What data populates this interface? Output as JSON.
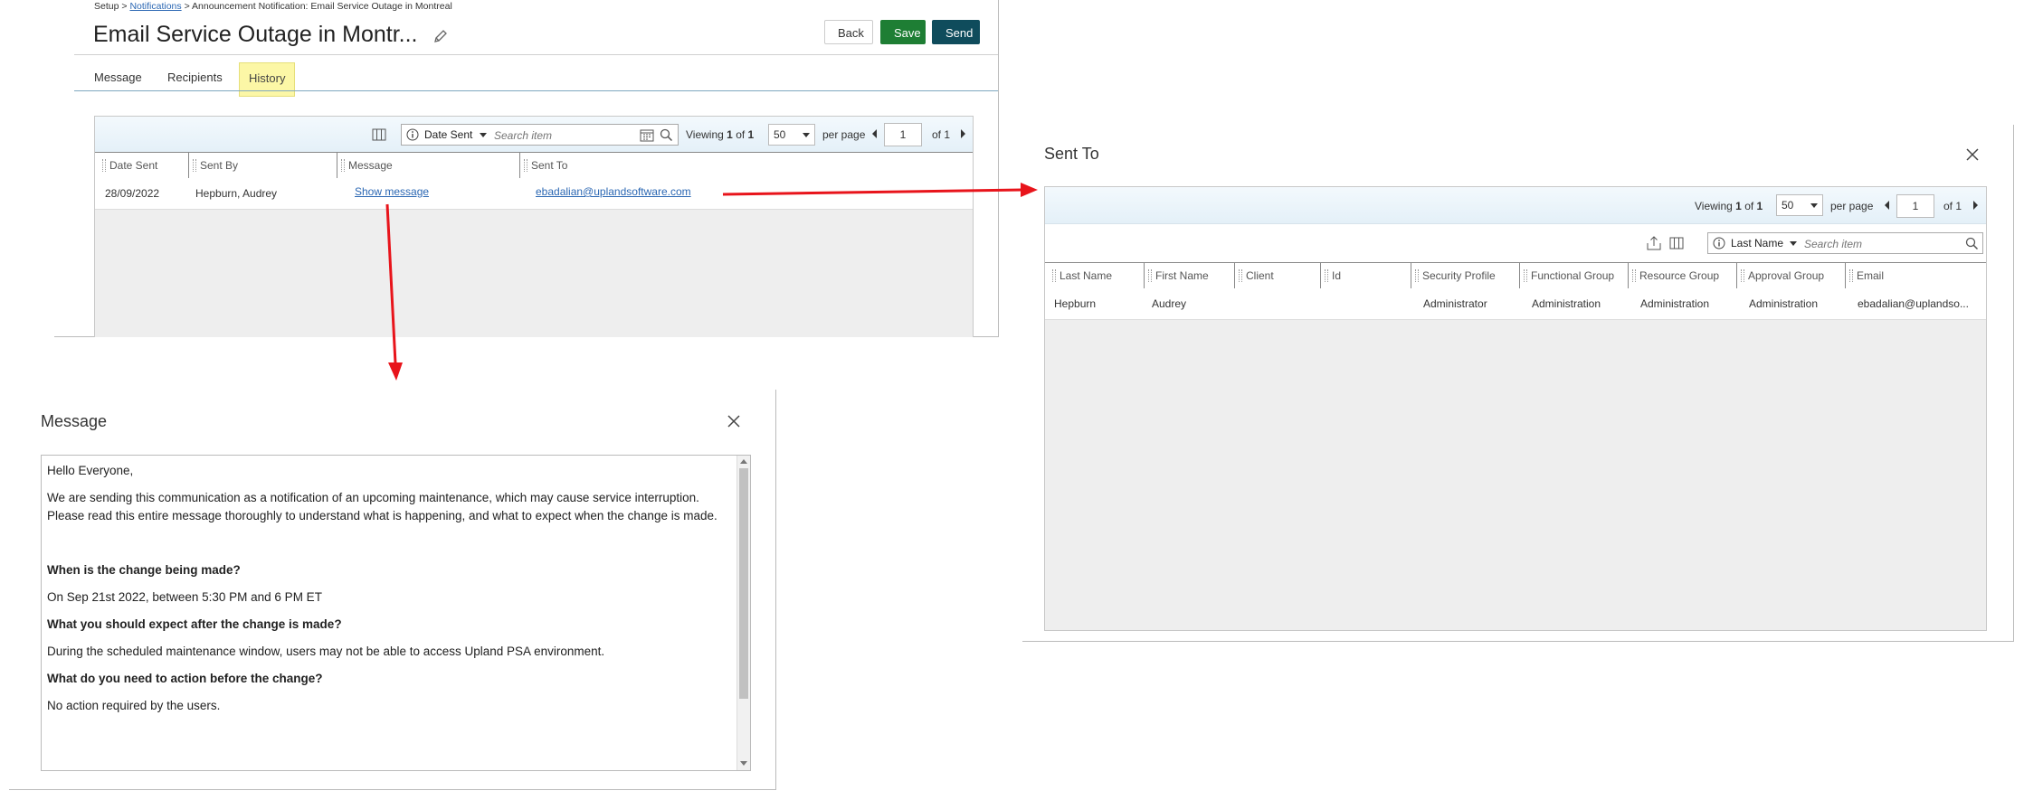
{
  "breadcrumb": {
    "setup": "Setup",
    "sep1": ">",
    "notifications": "Notifications",
    "sep2": ">",
    "current": "Announcement Notification: Email Service Outage in Montreal"
  },
  "page": {
    "title": "Email Service Outage in Montr...",
    "back_label": "Back",
    "save_label": "Save",
    "send_label": "Send"
  },
  "tabs": [
    {
      "label": "Message"
    },
    {
      "label": "Recipients"
    },
    {
      "label": "History",
      "active": true
    }
  ],
  "history_grid": {
    "filter_field": "Date Sent",
    "search_placeholder": "Search item",
    "viewing_label": "Viewing",
    "viewing_from": "1",
    "of_label": "of",
    "viewing_total": "1",
    "per_page_value": "50",
    "per_page_label": "per page",
    "page_value": "1",
    "page_of": "of 1",
    "columns": [
      "Date Sent",
      "Sent By",
      "Message",
      "Sent To"
    ],
    "rows": [
      {
        "date_sent": "28/09/2022",
        "sent_by": "Hepburn, Audrey",
        "message": "Show message",
        "sent_to": "ebadalian@uplandsoftware.com"
      }
    ]
  },
  "sent_to_dialog": {
    "title": "Sent To",
    "viewing_label": "Viewing",
    "viewing_from": "1",
    "of_label": "of",
    "viewing_total": "1",
    "per_page_value": "50",
    "per_page_label": "per page",
    "page_value": "1",
    "page_of": "of 1",
    "filter_field": "Last Name",
    "search_placeholder": "Search item",
    "columns": [
      "Last Name",
      "First Name",
      "Client",
      "Id",
      "Security Profile",
      "Functional Group",
      "Resource Group",
      "Approval Group",
      "Email"
    ],
    "rows": [
      {
        "last_name": "Hepburn",
        "first_name": "Audrey",
        "client": "",
        "id": "",
        "security_profile": "Administrator",
        "functional_group": "Administration",
        "resource_group": "Administration",
        "approval_group": "Administration",
        "email": "ebadalian@uplandso..."
      }
    ]
  },
  "message_dialog": {
    "title": "Message",
    "greeting": "Hello Everyone,",
    "intro": "We are sending this communication as a notification of an upcoming maintenance, which may cause service interruption. Please read this entire message thoroughly to understand what is happening, and what to expect when the change is made.",
    "q1": "When is the change being made?",
    "a1": "On Sep 21st 2022, between 5:30 PM and 6 PM ET",
    "q2": "What you should expect after the change is made?",
    "a2": "During the scheduled maintenance window, users may not be able to access Upland PSA environment.",
    "q3": "What do you need to action before the change?",
    "a3": "No action required by the users."
  },
  "colors": {
    "save": "#1e7e34",
    "send": "#0f4c5c",
    "arrow": "#e8141b",
    "tab_highlight": "#fcf7a6",
    "link": "#2b67b3"
  }
}
